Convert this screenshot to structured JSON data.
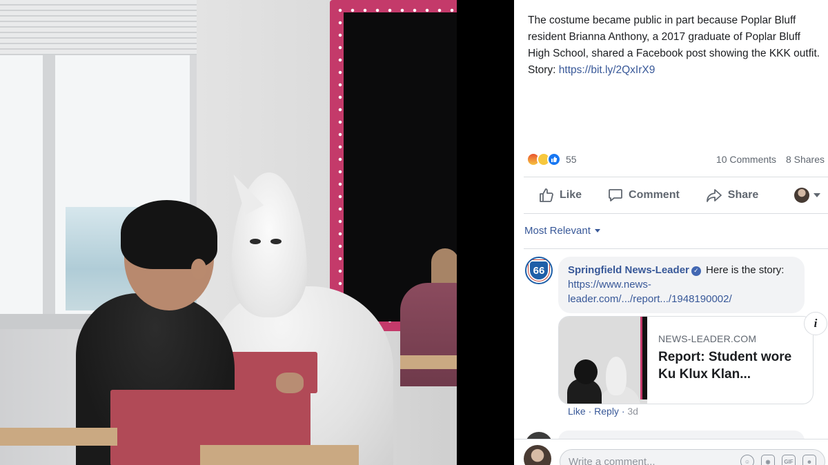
{
  "post": {
    "caption_text": "The costume became public in part because Poplar Bluff resident Brianna Anthony, a 2017 graduate of Poplar Bluff High School, shared a Facebook post showing the KKK outfit. Story: ",
    "caption_link": "https://bit.ly/2QxIrX9"
  },
  "reactions": {
    "count": "55",
    "comments": "10 Comments",
    "shares": "8 Shares",
    "icons": [
      "angry-icon",
      "wow-icon",
      "like-icon"
    ]
  },
  "actions": {
    "like": "Like",
    "comment": "Comment",
    "share": "Share"
  },
  "filter": {
    "label": "Most Relevant"
  },
  "comment": {
    "author": "Springfield News-Leader",
    "text": "Here is the story:",
    "link": "https://www.news-leader.com/.../report.../1948190002/",
    "avatar_text": "66",
    "card": {
      "domain": "NEWS-LEADER.COM",
      "title": "Report: Student wore Ku Klux Klan..."
    },
    "meta": {
      "like": "Like",
      "reply": "Reply",
      "time": "3d"
    }
  },
  "composer": {
    "placeholder": "Write a comment..."
  },
  "colors": {
    "link": "#385898",
    "text": "#1c1e21",
    "muted": "#606770",
    "like_blue": "#1877f2"
  }
}
